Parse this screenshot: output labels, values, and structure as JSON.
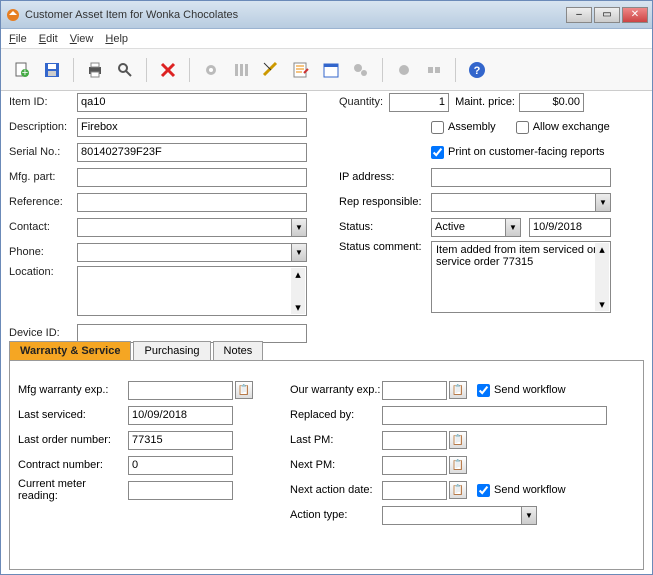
{
  "window": {
    "title": "Customer Asset Item for Wonka Chocolates"
  },
  "menu": {
    "file": "File",
    "edit": "Edit",
    "view": "View",
    "help": "Help"
  },
  "fields": {
    "item_id_lbl": "Item ID:",
    "item_id": "qa10",
    "desc_lbl": "Description:",
    "desc": "Firebox",
    "serial_lbl": "Serial No.:",
    "serial": "801402739F23F",
    "mfg_part_lbl": "Mfg. part:",
    "mfg_part": "",
    "reference_lbl": "Reference:",
    "reference": "",
    "contact_lbl": "Contact:",
    "contact": "",
    "phone_lbl": "Phone:",
    "phone": "",
    "location_lbl": "Location:",
    "location": "",
    "device_lbl": "Device ID:",
    "device": "",
    "qty_lbl": "Quantity:",
    "qty": "1",
    "maint_lbl": "Maint. price:",
    "maint": "$0.00",
    "assembly_lbl": "Assembly",
    "allow_exch_lbl": "Allow exchange",
    "print_lbl": "Print on customer-facing reports",
    "ip_lbl": "IP address:",
    "ip": "",
    "rep_lbl": "Rep responsible:",
    "rep": "",
    "status_lbl": "Status:",
    "status": "Active",
    "status_date": "10/9/2018",
    "comment_lbl": "Status comment:",
    "comment": "Item added from item serviced on service order 77315"
  },
  "tabs": {
    "warranty": "Warranty & Service",
    "purchasing": "Purchasing",
    "notes": "Notes"
  },
  "warranty": {
    "mfg_exp_lbl": "Mfg warranty exp.:",
    "mfg_exp": "",
    "last_serv_lbl": "Last serviced:",
    "last_serv": "10/09/2018",
    "last_order_lbl": "Last order number:",
    "last_order": "77315",
    "contract_lbl": "Contract number:",
    "contract": "0",
    "meter_lbl": "Current meter reading:",
    "meter": "",
    "our_exp_lbl": "Our warranty exp.:",
    "our_exp": "",
    "replaced_lbl": "Replaced by:",
    "replaced": "",
    "last_pm_lbl": "Last PM:",
    "last_pm": "",
    "next_pm_lbl": "Next PM:",
    "next_pm": "",
    "next_action_lbl": "Next action date:",
    "next_action": "",
    "action_type_lbl": "Action type:",
    "action_type": "",
    "send_wf_lbl": "Send workflow"
  }
}
